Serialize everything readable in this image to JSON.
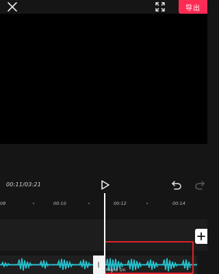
{
  "toolbar": {
    "close_icon": "close-icon",
    "fullscreen_icon": "fullscreen-icon",
    "export_label": "导出",
    "accent_color": "#fe2c55"
  },
  "playback": {
    "timecode": "00:11/03:21",
    "play_icon": "play-icon",
    "undo_icon": "undo-icon",
    "redo_icon": "redo-icon"
  },
  "ruler": {
    "labels": [
      "08",
      "00:10",
      "00:12",
      "00:14"
    ]
  },
  "timeline": {
    "add_icon": "plus-icon",
    "selected_clip_label": "Right On",
    "selection_color": "#e0222b",
    "waveform_color": "#27c3d0"
  }
}
